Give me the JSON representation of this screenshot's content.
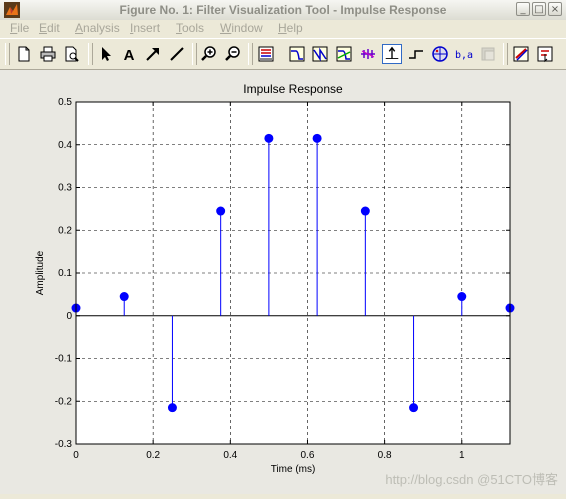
{
  "window": {
    "title": "Figure No. 1: Filter Visualization Tool - Impulse Response",
    "controls": [
      "_",
      "□",
      "×"
    ]
  },
  "menubar": {
    "items": [
      {
        "label": "File",
        "u": "F",
        "rest": "ile"
      },
      {
        "label": "Edit",
        "u": "E",
        "rest": "dit"
      },
      {
        "label": "Analysis",
        "u": "A",
        "rest": "nalysis"
      },
      {
        "label": "Insert",
        "u": "I",
        "rest": "nsert"
      },
      {
        "label": "Tools",
        "u": "T",
        "rest": "ools"
      },
      {
        "label": "Window",
        "u": "W",
        "rest": "indow"
      },
      {
        "label": "Help",
        "u": "H",
        "rest": "elp"
      }
    ]
  },
  "toolbar": {
    "buttons": [
      "new-document-icon",
      "print-icon",
      "print-preview-icon",
      "select-arrow-icon",
      "insert-text-icon",
      "insert-arrow-icon",
      "insert-line-icon",
      "zoom-in-icon",
      "zoom-out-icon",
      "filter-specs-icon",
      "magnitude-response-icon",
      "phase-response-icon",
      "magnitude-phase-icon",
      "group-delay-icon",
      "impulse-response-icon",
      "step-response-icon",
      "pole-zero-icon",
      "filter-coefficients-icon",
      "filter-info-icon",
      "legend-icon",
      "data-cursor-icon"
    ]
  },
  "chart_data": {
    "type": "stem",
    "title": "Impulse Response",
    "xlabel": "Time (ms)",
    "ylabel": "Amplitude",
    "xlim": [
      0,
      1.125
    ],
    "ylim": [
      -0.3,
      0.5
    ],
    "xticks": [
      0,
      0.2,
      0.4,
      0.6,
      0.8,
      1
    ],
    "xtick_labels": [
      "0",
      "0.2",
      "0.4",
      "0.6",
      "0.8",
      "1"
    ],
    "yticks": [
      -0.3,
      -0.2,
      -0.1,
      0,
      0.1,
      0.2,
      0.3,
      0.4,
      0.5
    ],
    "ytick_labels": [
      "-0.3",
      "-0.2",
      "-0.1",
      "0",
      "0.1",
      "0.2",
      "0.3",
      "0.4",
      "0.5"
    ],
    "grid": true,
    "color": "#0000ff",
    "x": [
      0,
      0.125,
      0.25,
      0.375,
      0.5,
      0.625,
      0.75,
      0.875,
      1.0,
      1.125
    ],
    "y": [
      0.018,
      0.045,
      -0.215,
      0.245,
      0.415,
      0.415,
      0.245,
      -0.215,
      0.045,
      0.018
    ]
  },
  "watermark": "http://blog.csdn @51CTO博客"
}
